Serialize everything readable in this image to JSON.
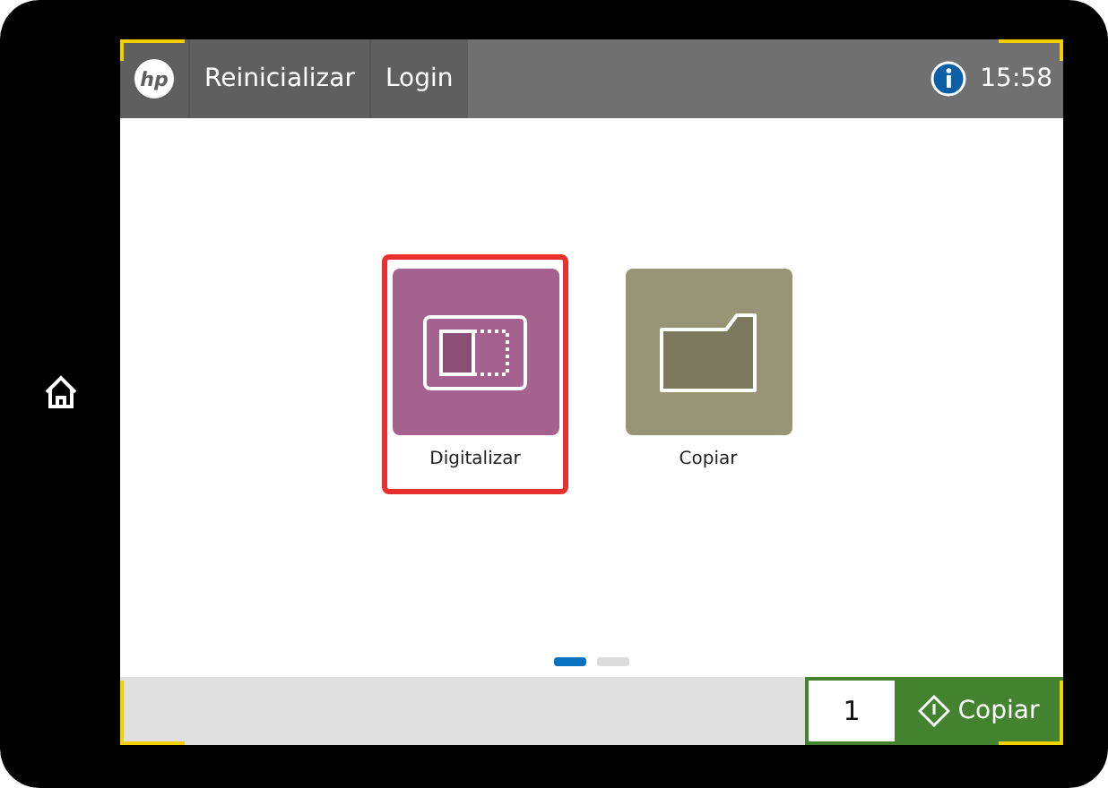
{
  "top_bar": {
    "logo": "hp",
    "buttons": [
      "Reinicializar",
      "Login"
    ],
    "time": "15:58"
  },
  "tiles": [
    {
      "label": "Digitalizar",
      "kind": "scan",
      "color": "#a6628f",
      "selected": true
    },
    {
      "label": "Copiar",
      "kind": "folder",
      "color": "#979575",
      "selected": false
    }
  ],
  "pages": [
    {
      "selected": true
    },
    {
      "selected": false
    }
  ],
  "bottom_bar": {
    "copies": "1",
    "action": "Copiar"
  }
}
